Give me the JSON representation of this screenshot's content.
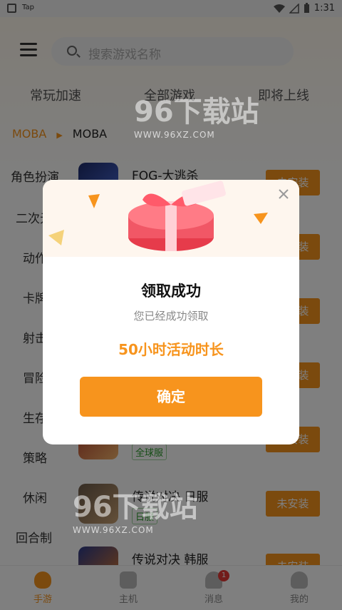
{
  "status_bar": {
    "app_label": "Tap",
    "time": "1:31"
  },
  "search": {
    "placeholder": "搜索游戏名称"
  },
  "tabs": [
    {
      "label": "常玩加速"
    },
    {
      "label": "全部游戏"
    },
    {
      "label": "即将上线"
    }
  ],
  "breadcrumb": {
    "parent": "MOBA",
    "current": "MOBA"
  },
  "categories": [
    {
      "label": "角色扮演"
    },
    {
      "label": "二次元"
    },
    {
      "label": "动作"
    },
    {
      "label": "卡牌"
    },
    {
      "label": "射击"
    },
    {
      "label": "冒险"
    },
    {
      "label": "生存"
    },
    {
      "label": "策略"
    },
    {
      "label": "休闲"
    },
    {
      "label": "回合制"
    }
  ],
  "games": [
    {
      "name": "FOG-大逃杀",
      "tag": "",
      "button": "未安装"
    },
    {
      "name": "",
      "tag": "",
      "button": "未安装"
    },
    {
      "name": "",
      "tag": "",
      "button": "未安装"
    },
    {
      "name": "",
      "tag": "",
      "button": "未安装"
    },
    {
      "name": "",
      "tag": "全球服",
      "button": "未安装"
    },
    {
      "name": "传说对决 日服",
      "tag": "日服",
      "button": "未安装"
    },
    {
      "name": "传说对决 韩服",
      "tag": "",
      "button": "未安装"
    }
  ],
  "bottom_nav": [
    {
      "label": "手游",
      "icon": "gamepad-face-icon"
    },
    {
      "label": "主机",
      "icon": "console-controller-icon"
    },
    {
      "label": "消息",
      "icon": "bell-icon",
      "badge": "1"
    },
    {
      "label": "我的",
      "icon": "user-icon"
    }
  ],
  "watermark": {
    "text": "下载站",
    "number": "96",
    "url": "WWW.96XZ.COM"
  },
  "modal": {
    "title": "领取成功",
    "subtitle": "您已经成功领取",
    "reward": "50小时活动时长",
    "confirm_label": "确定"
  },
  "colors": {
    "accent": "#f7941d",
    "overlay": "rgba(0,0,0,0.5)",
    "badge": "#e53935"
  }
}
